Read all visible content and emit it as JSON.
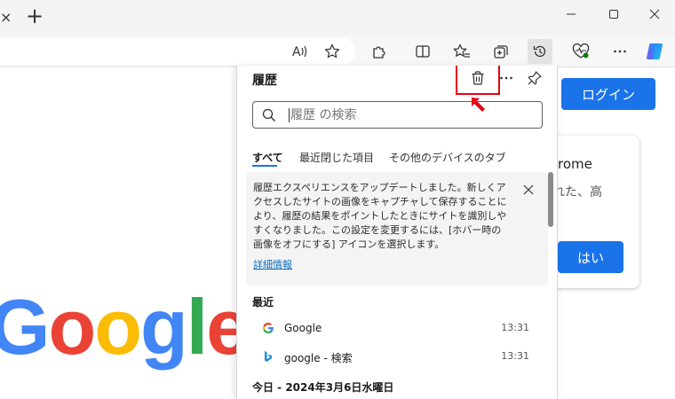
{
  "browser": {
    "tab_close_glyph": "×",
    "new_tab_glyph": "+",
    "read_aloud_glyph": "A))"
  },
  "page": {
    "login_label": "ログイン",
    "promo_title": "rome",
    "promo_text": "れた、高",
    "yes_label": "はい",
    "logo_letters": [
      "G",
      "o",
      "o",
      "g",
      "l",
      "e"
    ],
    "logo_colors": [
      "#4285f4",
      "#ea4335",
      "#fbbc05",
      "#4285f4",
      "#34a853",
      "#ea4335"
    ]
  },
  "history": {
    "title": "履歴",
    "search_placeholder": "履歴 の検索",
    "tabs": [
      "すべて",
      "最近閉じた項目",
      "その他のデバイスのタブ"
    ],
    "notice_text": "履歴エクスペリエンスをアップデートしました。新しくアクセスしたサイトの画像をキャプチャして保存することにより、履歴の結果をポイントしたときにサイトを識別しやすくなりました。この設定を変更するには、[ホバー時の画像をオフにする] アイコンを選択します。",
    "notice_link": "詳細情報",
    "recent_label": "最近",
    "items": [
      {
        "title": "Google",
        "time": "13:31",
        "icon": "google-favicon"
      },
      {
        "title": "google - 検索",
        "time": "13:31",
        "icon": "bing-favicon"
      }
    ],
    "today_label": "今日 - 2024年3月6日水曜日"
  },
  "colors": {
    "accent": "#1a73e8",
    "highlight": "#e60012",
    "link": "#0f6cbd"
  }
}
